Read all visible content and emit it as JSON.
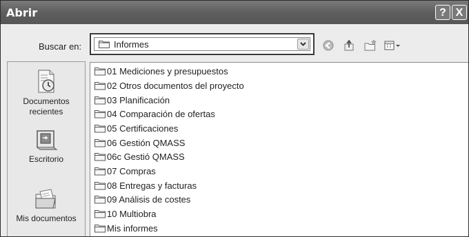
{
  "window": {
    "title": "Abrir",
    "help_label": "?",
    "close_label": "X"
  },
  "lookin": {
    "label": "Buscar en:",
    "value": "Informes"
  },
  "places": [
    {
      "label": "Documentos recientes",
      "icon": "recent-documents-icon"
    },
    {
      "label": "Escritorio",
      "icon": "desktop-icon"
    },
    {
      "label": "Mis documentos",
      "icon": "my-documents-icon"
    }
  ],
  "files": [
    {
      "name": "01 Mediciones y presupuestos"
    },
    {
      "name": "02 Otros documentos del proyecto"
    },
    {
      "name": "03 Planificación"
    },
    {
      "name": "04 Comparación de ofertas"
    },
    {
      "name": "05 Certificaciones"
    },
    {
      "name": "06 Gestión QMASS"
    },
    {
      "name": "06c Gestió QMASS"
    },
    {
      "name": "07 Compras"
    },
    {
      "name": "08 Entregas y facturas"
    },
    {
      "name": "09 Análisis de costes"
    },
    {
      "name": "10 Multiobra"
    },
    {
      "name": "Mis informes"
    }
  ]
}
